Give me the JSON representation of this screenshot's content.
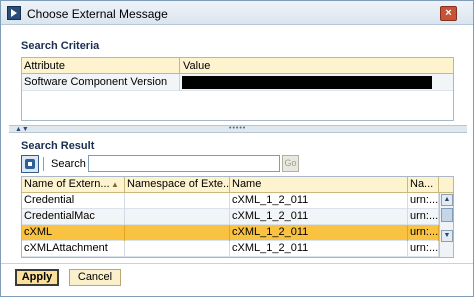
{
  "window": {
    "title": "Choose External Message",
    "close_glyph": "×"
  },
  "search_criteria": {
    "heading": "Search Criteria",
    "columns": [
      "Attribute",
      "Value"
    ],
    "rows": [
      {
        "attribute": "Software Component Version",
        "value_redacted": true
      }
    ]
  },
  "search_result": {
    "heading": "Search Result",
    "search_label": "Search",
    "search_value": "",
    "go_label": "Go",
    "columns": [
      "Name of Extern...",
      "Namespace of Exte...",
      "Name",
      "Na..."
    ],
    "rows": [
      {
        "name_ext": "Credential",
        "namespace": "",
        "name": "cXML_1_2_011",
        "na": "urn:..."
      },
      {
        "name_ext": "CredentialMac",
        "namespace": "",
        "name": "cXML_1_2_011",
        "na": "urn:..."
      },
      {
        "name_ext": "cXML",
        "namespace": "",
        "name": "cXML_1_2_011",
        "na": "urn:...",
        "selected": true
      },
      {
        "name_ext": "cXMLAttachment",
        "namespace": "",
        "name": "cXML_1_2_011",
        "na": "urn:..."
      }
    ]
  },
  "buttons": {
    "apply": "Apply",
    "cancel": "Cancel"
  },
  "colors": {
    "selected_row": "#f9c240",
    "header_bg": "#fdf3cf",
    "title_bg": "#dbe5ef"
  },
  "icons": [
    "app-icon",
    "close-icon",
    "refresh-icon",
    "sort-icon",
    "scroll-up-icon",
    "scroll-down-icon"
  ]
}
